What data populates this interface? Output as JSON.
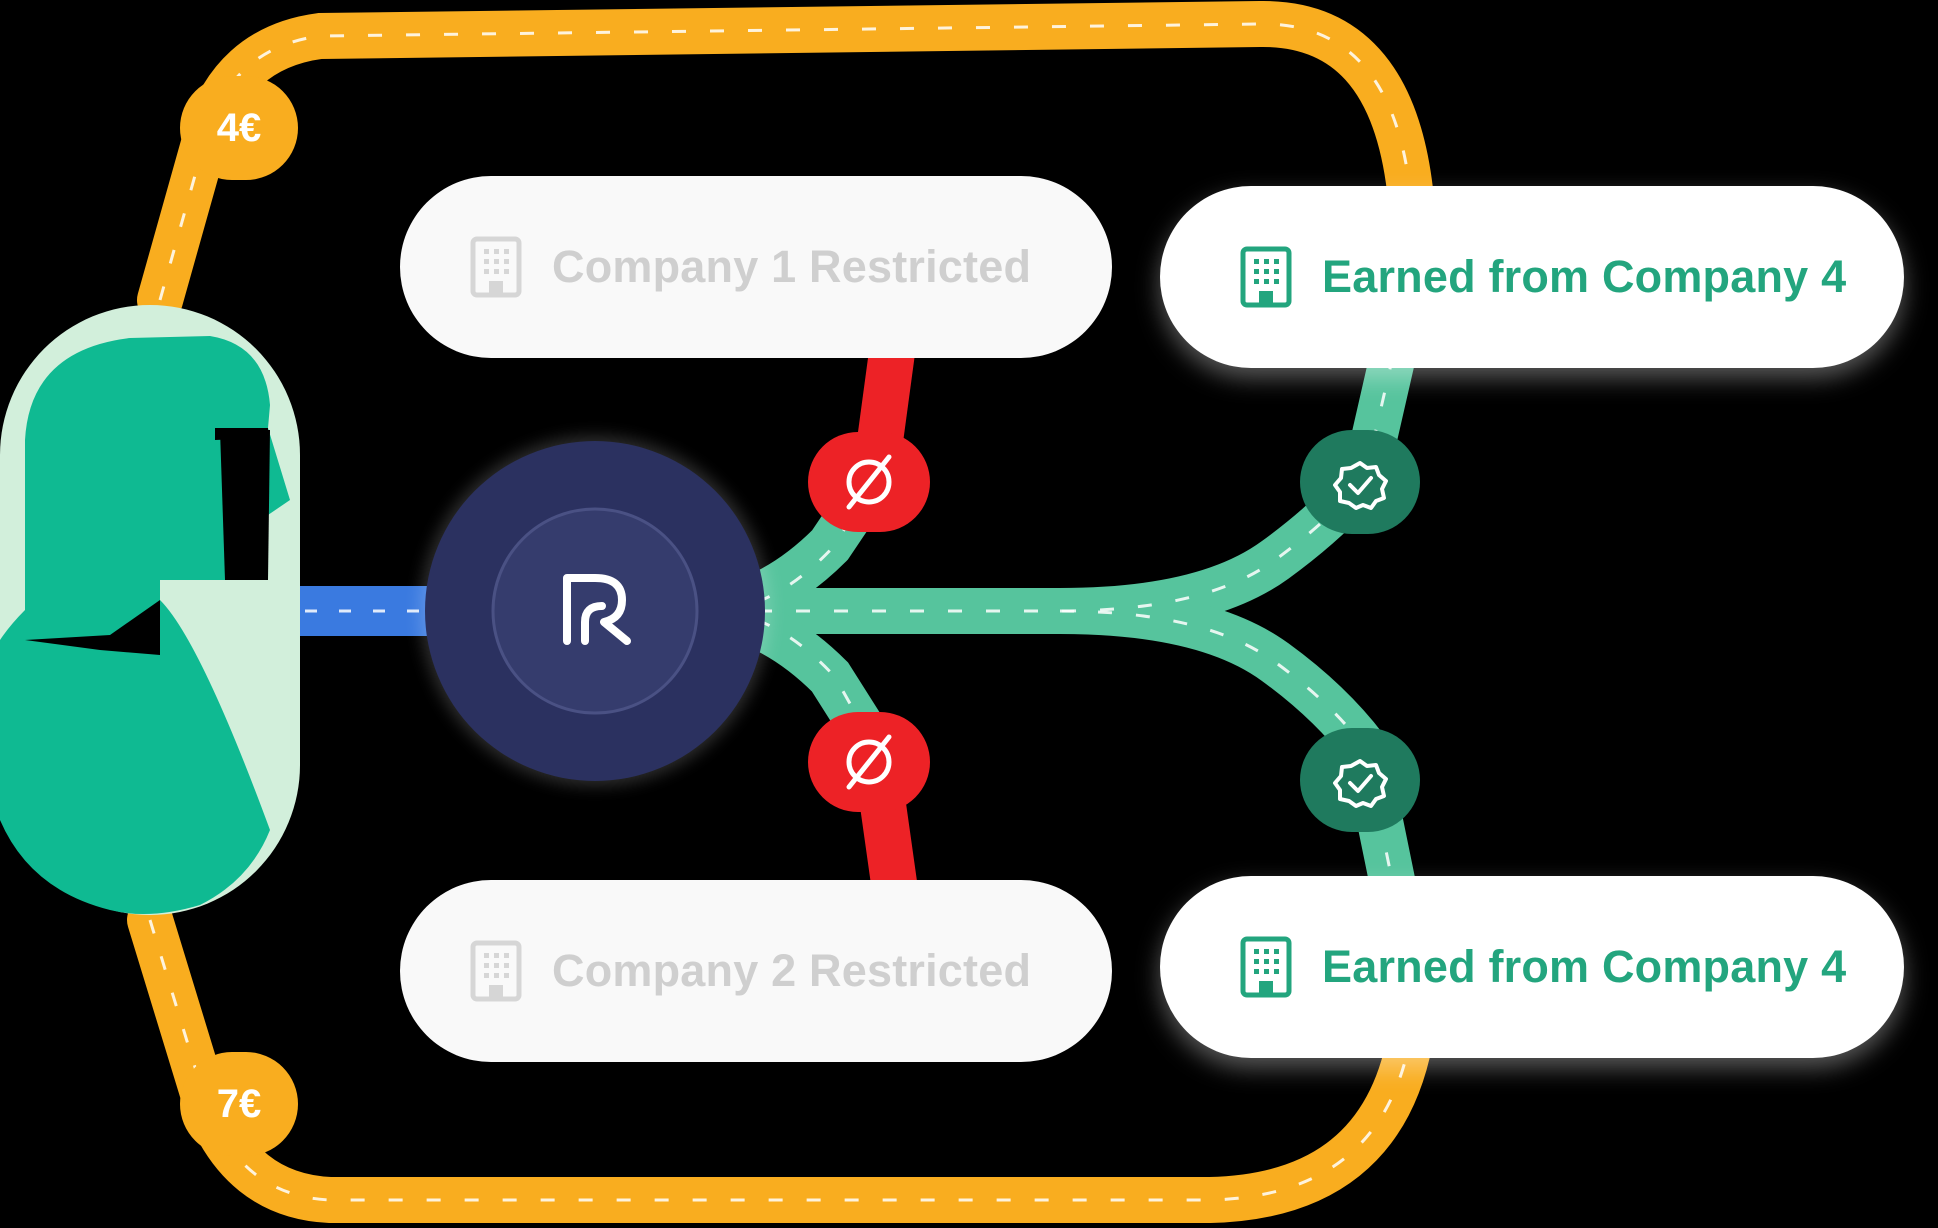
{
  "colors": {
    "road_orange": "#f9ad1f",
    "road_green": "#56c49d",
    "road_red": "#ed2226",
    "road_blue": "#3a7ae0",
    "hub_navy": "#2b3160",
    "check_badge": "#1f7a5e",
    "person_green": "#0fba92",
    "person_bg": "#d2efdb",
    "label_green": "#23a57e",
    "label_grey": "#cfcfcf"
  },
  "prices": {
    "top": "4€",
    "bottom": "7€"
  },
  "companies": {
    "restricted_1": {
      "label": "Company 1 Restricted",
      "icon": "building-icon"
    },
    "restricted_2": {
      "label": "Company 2 Restricted",
      "icon": "building-icon"
    },
    "earned_1": {
      "label": "Earned from Company 4",
      "icon": "building-icon"
    },
    "earned_2": {
      "label": "Earned from Company 4",
      "icon": "building-icon"
    }
  },
  "badges": {
    "blocked": "empty-set-icon",
    "approved": "verified-check-icon"
  },
  "hub": {
    "icon": "brand-logo-icon"
  },
  "person": {
    "icon": "person-avatar-icon"
  }
}
